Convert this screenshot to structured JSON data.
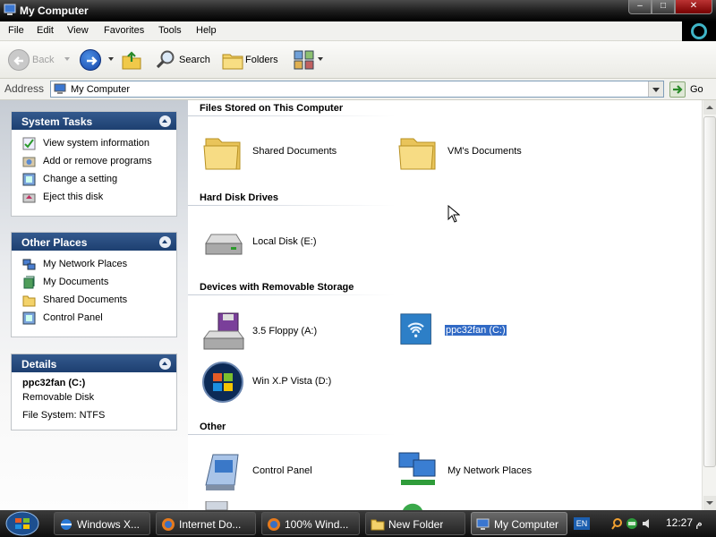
{
  "window": {
    "title": "My Computer"
  },
  "menu": [
    "File",
    "Edit",
    "View",
    "Favorites",
    "Tools",
    "Help"
  ],
  "toolbar": {
    "back_label": "Back",
    "search_label": "Search",
    "folders_label": "Folders"
  },
  "address": {
    "label": "Address",
    "value": "My Computer",
    "go_label": "Go"
  },
  "sidebar": {
    "system_tasks": {
      "title": "System Tasks",
      "items": [
        {
          "label": "View system information",
          "icon": "system-info-icon"
        },
        {
          "label": "Add or remove programs",
          "icon": "add-remove-programs-icon"
        },
        {
          "label": "Change a setting",
          "icon": "control-panel-icon"
        },
        {
          "label": "Eject this disk",
          "icon": "eject-icon"
        }
      ]
    },
    "other_places": {
      "title": "Other Places",
      "items": [
        {
          "label": "My Network Places",
          "icon": "network-places-icon"
        },
        {
          "label": "My Documents",
          "icon": "my-documents-icon"
        },
        {
          "label": "Shared Documents",
          "icon": "folder-icon"
        },
        {
          "label": "Control Panel",
          "icon": "control-panel-icon"
        }
      ]
    },
    "details": {
      "title": "Details",
      "name": "ppc32fan (C:)",
      "type": "Removable Disk",
      "filesystem": "File System: NTFS"
    }
  },
  "content": {
    "groups": [
      {
        "title": "Files Stored on This Computer"
      },
      {
        "title": "Hard Disk Drives"
      },
      {
        "title": "Devices with Removable Storage"
      },
      {
        "title": "Other"
      }
    ],
    "items": {
      "shared_documents": "Shared Documents",
      "vms_documents": "VM's Documents",
      "local_disk": "Local Disk (E:)",
      "floppy": "3.5 Floppy (A:)",
      "ppc32fan": "ppc32fan (C:)",
      "winxp_vista": "Win X.P Vista (D:)",
      "control_panel": "Control Panel",
      "network_places": "My Network Places"
    },
    "selected_item": "ppc32fan (C:)"
  },
  "taskbar": {
    "buttons": [
      {
        "label": "Windows X...",
        "icon": "ie-icon"
      },
      {
        "label": "Internet Do...",
        "icon": "firefox-icon"
      },
      {
        "label": "100% Wind...",
        "icon": "firefox-icon"
      },
      {
        "label": "New Folder",
        "icon": "folder-icon"
      },
      {
        "label": "My Computer",
        "icon": "my-computer-icon"
      }
    ],
    "language": "EN",
    "clock": "12:27 م"
  },
  "colors": {
    "panel_header": "#1d3f70",
    "selection": "#316ac5",
    "titlebar": "#1b1b1b",
    "taskbar": "#1a1a1a"
  }
}
